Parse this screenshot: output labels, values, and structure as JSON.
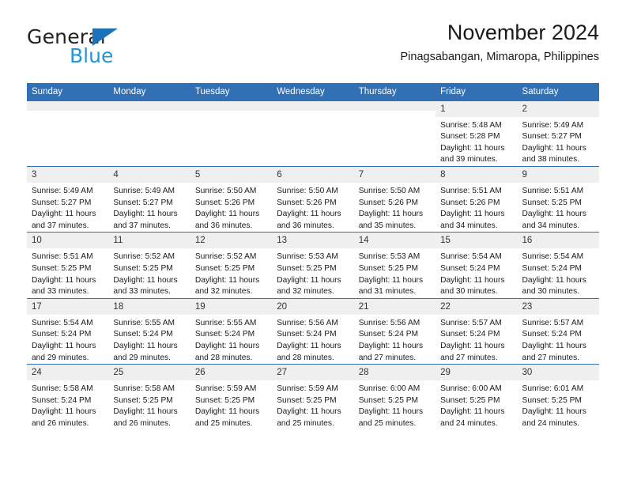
{
  "brand": {
    "word_one": "General",
    "word_two": "Blue",
    "triangle_color": "#1c72b8",
    "blue_text_color": "#2196d8"
  },
  "header": {
    "title": "November 2024",
    "subtitle": "Pinagsabangan, Mimaropa, Philippines"
  },
  "theme": {
    "header_bg": "#3170b4",
    "daynum_bg": "#efefef",
    "page_bg": "#ffffff",
    "row_separator": "#3170b4"
  },
  "weekdays": [
    "Sunday",
    "Monday",
    "Tuesday",
    "Wednesday",
    "Thursday",
    "Friday",
    "Saturday"
  ],
  "weeks": [
    [
      {
        "day": "",
        "sunrise": "",
        "sunset": "",
        "daylight_line1": "",
        "daylight_line2": "",
        "empty": true
      },
      {
        "day": "",
        "sunrise": "",
        "sunset": "",
        "daylight_line1": "",
        "daylight_line2": "",
        "empty": true
      },
      {
        "day": "",
        "sunrise": "",
        "sunset": "",
        "daylight_line1": "",
        "daylight_line2": "",
        "empty": true
      },
      {
        "day": "",
        "sunrise": "",
        "sunset": "",
        "daylight_line1": "",
        "daylight_line2": "",
        "empty": true
      },
      {
        "day": "",
        "sunrise": "",
        "sunset": "",
        "daylight_line1": "",
        "daylight_line2": "",
        "empty": true
      },
      {
        "day": "1",
        "sunrise": "Sunrise: 5:48 AM",
        "sunset": "Sunset: 5:28 PM",
        "daylight_line1": "Daylight: 11 hours",
        "daylight_line2": "and 39 minutes."
      },
      {
        "day": "2",
        "sunrise": "Sunrise: 5:49 AM",
        "sunset": "Sunset: 5:27 PM",
        "daylight_line1": "Daylight: 11 hours",
        "daylight_line2": "and 38 minutes."
      }
    ],
    [
      {
        "day": "3",
        "sunrise": "Sunrise: 5:49 AM",
        "sunset": "Sunset: 5:27 PM",
        "daylight_line1": "Daylight: 11 hours",
        "daylight_line2": "and 37 minutes."
      },
      {
        "day": "4",
        "sunrise": "Sunrise: 5:49 AM",
        "sunset": "Sunset: 5:27 PM",
        "daylight_line1": "Daylight: 11 hours",
        "daylight_line2": "and 37 minutes."
      },
      {
        "day": "5",
        "sunrise": "Sunrise: 5:50 AM",
        "sunset": "Sunset: 5:26 PM",
        "daylight_line1": "Daylight: 11 hours",
        "daylight_line2": "and 36 minutes."
      },
      {
        "day": "6",
        "sunrise": "Sunrise: 5:50 AM",
        "sunset": "Sunset: 5:26 PM",
        "daylight_line1": "Daylight: 11 hours",
        "daylight_line2": "and 36 minutes."
      },
      {
        "day": "7",
        "sunrise": "Sunrise: 5:50 AM",
        "sunset": "Sunset: 5:26 PM",
        "daylight_line1": "Daylight: 11 hours",
        "daylight_line2": "and 35 minutes."
      },
      {
        "day": "8",
        "sunrise": "Sunrise: 5:51 AM",
        "sunset": "Sunset: 5:26 PM",
        "daylight_line1": "Daylight: 11 hours",
        "daylight_line2": "and 34 minutes."
      },
      {
        "day": "9",
        "sunrise": "Sunrise: 5:51 AM",
        "sunset": "Sunset: 5:25 PM",
        "daylight_line1": "Daylight: 11 hours",
        "daylight_line2": "and 34 minutes."
      }
    ],
    [
      {
        "day": "10",
        "sunrise": "Sunrise: 5:51 AM",
        "sunset": "Sunset: 5:25 PM",
        "daylight_line1": "Daylight: 11 hours",
        "daylight_line2": "and 33 minutes."
      },
      {
        "day": "11",
        "sunrise": "Sunrise: 5:52 AM",
        "sunset": "Sunset: 5:25 PM",
        "daylight_line1": "Daylight: 11 hours",
        "daylight_line2": "and 33 minutes."
      },
      {
        "day": "12",
        "sunrise": "Sunrise: 5:52 AM",
        "sunset": "Sunset: 5:25 PM",
        "daylight_line1": "Daylight: 11 hours",
        "daylight_line2": "and 32 minutes."
      },
      {
        "day": "13",
        "sunrise": "Sunrise: 5:53 AM",
        "sunset": "Sunset: 5:25 PM",
        "daylight_line1": "Daylight: 11 hours",
        "daylight_line2": "and 32 minutes."
      },
      {
        "day": "14",
        "sunrise": "Sunrise: 5:53 AM",
        "sunset": "Sunset: 5:25 PM",
        "daylight_line1": "Daylight: 11 hours",
        "daylight_line2": "and 31 minutes."
      },
      {
        "day": "15",
        "sunrise": "Sunrise: 5:54 AM",
        "sunset": "Sunset: 5:24 PM",
        "daylight_line1": "Daylight: 11 hours",
        "daylight_line2": "and 30 minutes."
      },
      {
        "day": "16",
        "sunrise": "Sunrise: 5:54 AM",
        "sunset": "Sunset: 5:24 PM",
        "daylight_line1": "Daylight: 11 hours",
        "daylight_line2": "and 30 minutes."
      }
    ],
    [
      {
        "day": "17",
        "sunrise": "Sunrise: 5:54 AM",
        "sunset": "Sunset: 5:24 PM",
        "daylight_line1": "Daylight: 11 hours",
        "daylight_line2": "and 29 minutes."
      },
      {
        "day": "18",
        "sunrise": "Sunrise: 5:55 AM",
        "sunset": "Sunset: 5:24 PM",
        "daylight_line1": "Daylight: 11 hours",
        "daylight_line2": "and 29 minutes."
      },
      {
        "day": "19",
        "sunrise": "Sunrise: 5:55 AM",
        "sunset": "Sunset: 5:24 PM",
        "daylight_line1": "Daylight: 11 hours",
        "daylight_line2": "and 28 minutes."
      },
      {
        "day": "20",
        "sunrise": "Sunrise: 5:56 AM",
        "sunset": "Sunset: 5:24 PM",
        "daylight_line1": "Daylight: 11 hours",
        "daylight_line2": "and 28 minutes."
      },
      {
        "day": "21",
        "sunrise": "Sunrise: 5:56 AM",
        "sunset": "Sunset: 5:24 PM",
        "daylight_line1": "Daylight: 11 hours",
        "daylight_line2": "and 27 minutes."
      },
      {
        "day": "22",
        "sunrise": "Sunrise: 5:57 AM",
        "sunset": "Sunset: 5:24 PM",
        "daylight_line1": "Daylight: 11 hours",
        "daylight_line2": "and 27 minutes."
      },
      {
        "day": "23",
        "sunrise": "Sunrise: 5:57 AM",
        "sunset": "Sunset: 5:24 PM",
        "daylight_line1": "Daylight: 11 hours",
        "daylight_line2": "and 27 minutes."
      }
    ],
    [
      {
        "day": "24",
        "sunrise": "Sunrise: 5:58 AM",
        "sunset": "Sunset: 5:24 PM",
        "daylight_line1": "Daylight: 11 hours",
        "daylight_line2": "and 26 minutes."
      },
      {
        "day": "25",
        "sunrise": "Sunrise: 5:58 AM",
        "sunset": "Sunset: 5:25 PM",
        "daylight_line1": "Daylight: 11 hours",
        "daylight_line2": "and 26 minutes."
      },
      {
        "day": "26",
        "sunrise": "Sunrise: 5:59 AM",
        "sunset": "Sunset: 5:25 PM",
        "daylight_line1": "Daylight: 11 hours",
        "daylight_line2": "and 25 minutes."
      },
      {
        "day": "27",
        "sunrise": "Sunrise: 5:59 AM",
        "sunset": "Sunset: 5:25 PM",
        "daylight_line1": "Daylight: 11 hours",
        "daylight_line2": "and 25 minutes."
      },
      {
        "day": "28",
        "sunrise": "Sunrise: 6:00 AM",
        "sunset": "Sunset: 5:25 PM",
        "daylight_line1": "Daylight: 11 hours",
        "daylight_line2": "and 25 minutes."
      },
      {
        "day": "29",
        "sunrise": "Sunrise: 6:00 AM",
        "sunset": "Sunset: 5:25 PM",
        "daylight_line1": "Daylight: 11 hours",
        "daylight_line2": "and 24 minutes."
      },
      {
        "day": "30",
        "sunrise": "Sunrise: 6:01 AM",
        "sunset": "Sunset: 5:25 PM",
        "daylight_line1": "Daylight: 11 hours",
        "daylight_line2": "and 24 minutes."
      }
    ]
  ]
}
